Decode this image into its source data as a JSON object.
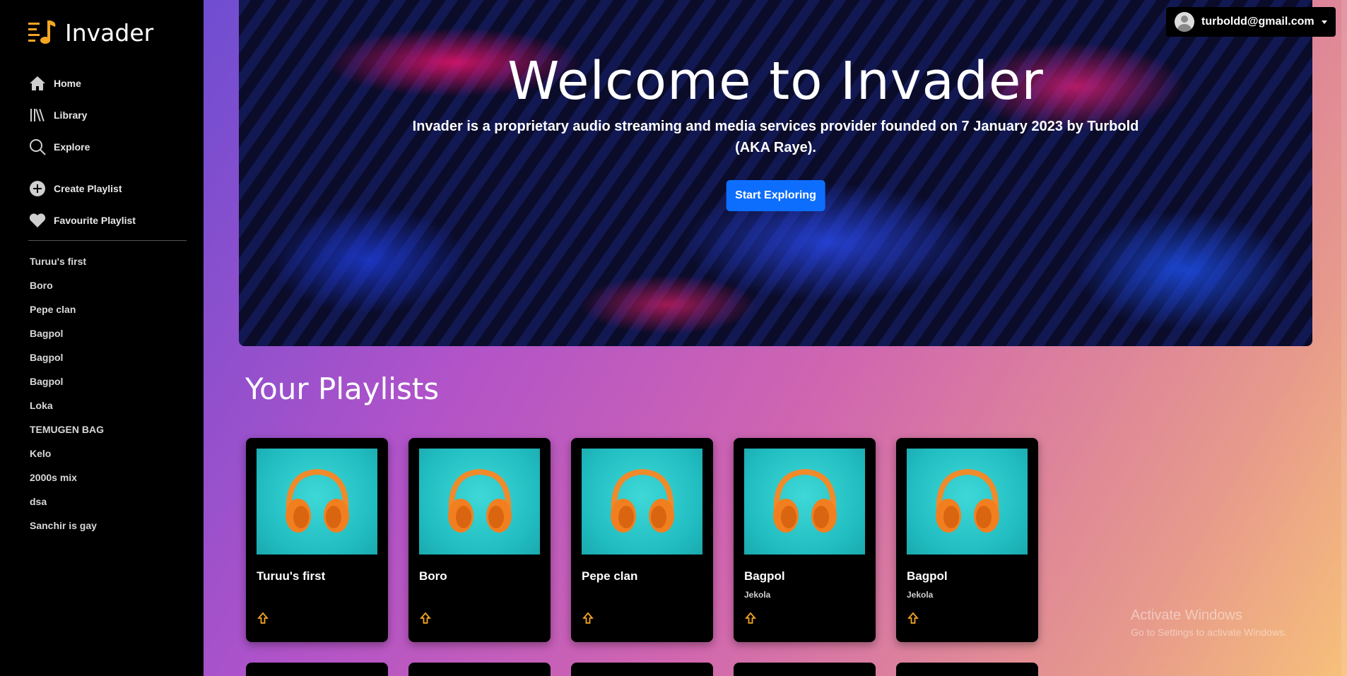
{
  "app": {
    "name": "Invader"
  },
  "nav": {
    "home": "Home",
    "library": "Library",
    "explore": "Explore",
    "create_playlist": "Create Playlist",
    "favourite_playlist": "Favourite Playlist"
  },
  "sidebar_playlists": [
    "Turuu's first",
    "Boro",
    "Pepe clan",
    "Bagpol",
    "Bagpol",
    "Bagpol",
    "Loka",
    "TEMUGEN BAG",
    "Kelo",
    "2000s mix",
    "dsa",
    "Sanchir is gay"
  ],
  "user": {
    "email": "turboldd@gmail.com"
  },
  "hero": {
    "title": "Welcome to Invader",
    "description": "Invader is a proprietary audio streaming and media services provider founded on 7 January 2023 by Turbold (AKA Raye).",
    "button": "Start Exploring"
  },
  "section": {
    "title": "Your Playlists"
  },
  "cards": [
    {
      "title": "Turuu's first",
      "subtitle": ""
    },
    {
      "title": "Boro",
      "subtitle": ""
    },
    {
      "title": "Pepe clan",
      "subtitle": ""
    },
    {
      "title": "Bagpol",
      "subtitle": "Jekola"
    },
    {
      "title": "Bagpol",
      "subtitle": "Jekola"
    }
  ],
  "watermark": {
    "line1": "Activate Windows",
    "line2": "Go to Settings to activate Windows."
  },
  "colors": {
    "accent": "#0d6efd",
    "logo": "#f5a623",
    "share_icon": "#f5a623",
    "card_bg": "#000000"
  }
}
